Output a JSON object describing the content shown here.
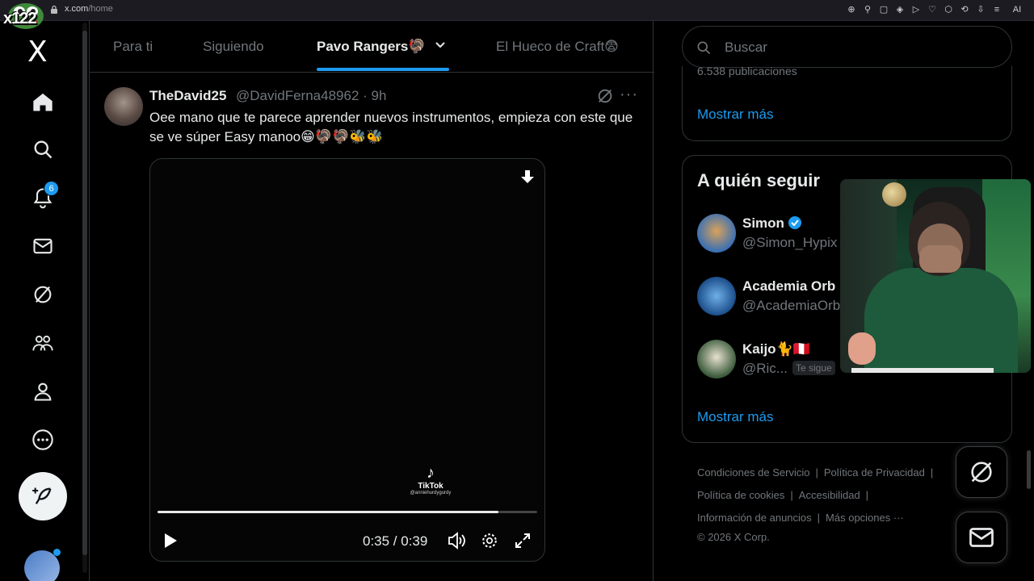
{
  "browser": {
    "host": "x.com",
    "path": "/home",
    "extension_icons": [
      "zoom-icon",
      "bookmark-pin-icon",
      "reader-icon",
      "shield-icon",
      "play-icon",
      "heart-icon",
      "extension-icon",
      "share-icon",
      "download-icon",
      "settings-icon",
      "ai-icon"
    ],
    "ai_label": "AI"
  },
  "overlay": {
    "streamer_tag": "x122"
  },
  "nav": {
    "logo": "X",
    "notifications_badge": "6",
    "items": [
      "home-icon",
      "search-icon",
      "notifications-icon",
      "messages-icon",
      "grok-icon",
      "communities-icon",
      "profile-icon",
      "more-icon"
    ]
  },
  "tabs": [
    {
      "label": "Para ti",
      "active": false
    },
    {
      "label": "Siguiendo",
      "active": false
    },
    {
      "label": "Pavo Rangers🦃",
      "active": true
    },
    {
      "label": "El Hueco de Craft😨",
      "active": false
    }
  ],
  "tweet": {
    "name": "TheDavid25",
    "handle": "@DavidFerna48962 · 9h",
    "text": "Oee mano que te parece aprender nuevos instrumentos, empieza con este que se ve súper Easy manoo😁🦃🦃🐝🐝",
    "video": {
      "watermark_brand": "TikTok",
      "watermark_user": "@anniehurdygurdy",
      "progress": 0.897,
      "time": "0:35 / 0:39"
    }
  },
  "search": {
    "placeholder": "Buscar"
  },
  "trends": {
    "cutoff_text": "6.538 publicaciones",
    "show_more": "Mostrar más"
  },
  "who_to_follow": {
    "title": "A quién seguir",
    "users": [
      {
        "name": "Simon",
        "handle": "@Simon_Hypix",
        "verified": true,
        "follows_you": false
      },
      {
        "name": "Academia Orb",
        "handle": "@AcademiaOrb",
        "verified": false,
        "follows_you": false
      },
      {
        "name": "Kaijo🐈🇵🇪",
        "handle": "@Ric...",
        "verified": false,
        "follows_you": true
      }
    ],
    "follows_you_label": "Te sigue",
    "show_more": "Mostrar más"
  },
  "footer": {
    "links": [
      "Condiciones de Servicio",
      "Política de Privacidad",
      "Política de cookies",
      "Accesibilidad",
      "Información de anuncios",
      "Más opciones ···"
    ],
    "copyright": "© 2026 X Corp."
  },
  "colors": {
    "accent": "#1d9bf0",
    "background": "#000000",
    "muted": "#71767b",
    "text": "#e7e9ea"
  }
}
